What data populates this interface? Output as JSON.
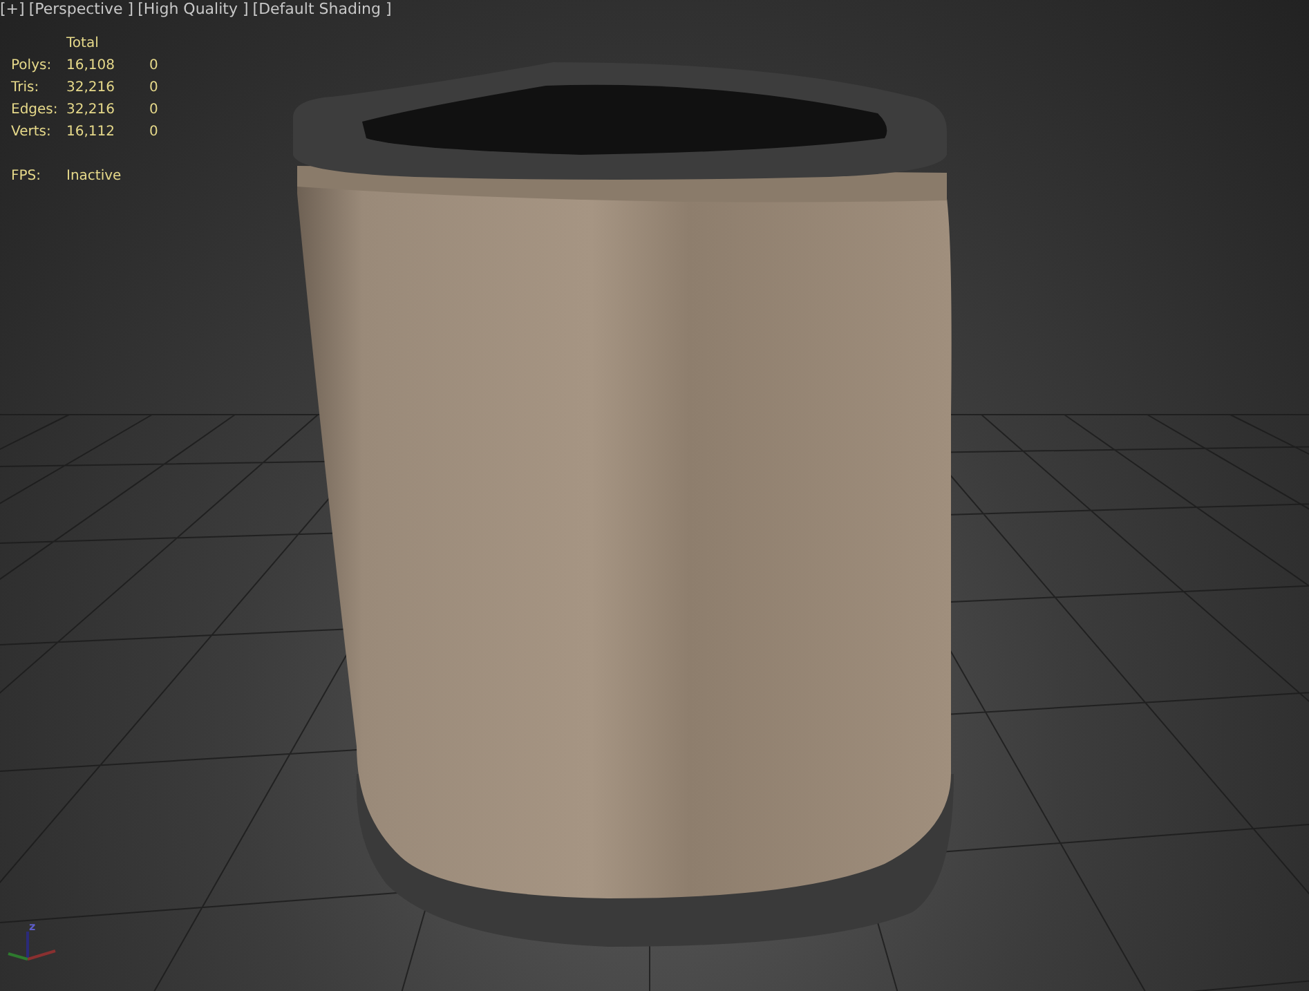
{
  "viewport_labels": [
    {
      "label": "[+]"
    },
    {
      "label": "[Perspective ]"
    },
    {
      "label": "[High Quality ]"
    },
    {
      "label": "[Default Shading ]"
    }
  ],
  "statistics": {
    "header": "Total",
    "rows": [
      {
        "label": "Polys:",
        "total": "16,108",
        "selected": "0"
      },
      {
        "label": "Tris:",
        "total": "32,216",
        "selected": "0"
      },
      {
        "label": "Edges:",
        "total": "32,216",
        "selected": "0"
      },
      {
        "label": "Verts:",
        "total": "16,112",
        "selected": "0"
      }
    ],
    "fps": {
      "label": "FPS:",
      "value": "Inactive"
    }
  },
  "axis_gizmo": {
    "label": "z"
  }
}
